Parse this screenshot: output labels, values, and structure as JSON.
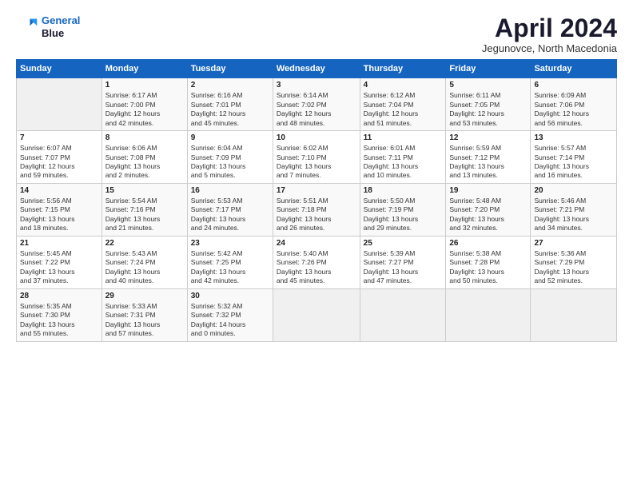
{
  "header": {
    "logo_line1": "General",
    "logo_line2": "Blue",
    "month_title": "April 2024",
    "location": "Jegunovce, North Macedonia"
  },
  "days_of_week": [
    "Sunday",
    "Monday",
    "Tuesday",
    "Wednesday",
    "Thursday",
    "Friday",
    "Saturday"
  ],
  "weeks": [
    [
      {
        "num": "",
        "content": ""
      },
      {
        "num": "1",
        "content": "Sunrise: 6:17 AM\nSunset: 7:00 PM\nDaylight: 12 hours\nand 42 minutes."
      },
      {
        "num": "2",
        "content": "Sunrise: 6:16 AM\nSunset: 7:01 PM\nDaylight: 12 hours\nand 45 minutes."
      },
      {
        "num": "3",
        "content": "Sunrise: 6:14 AM\nSunset: 7:02 PM\nDaylight: 12 hours\nand 48 minutes."
      },
      {
        "num": "4",
        "content": "Sunrise: 6:12 AM\nSunset: 7:04 PM\nDaylight: 12 hours\nand 51 minutes."
      },
      {
        "num": "5",
        "content": "Sunrise: 6:11 AM\nSunset: 7:05 PM\nDaylight: 12 hours\nand 53 minutes."
      },
      {
        "num": "6",
        "content": "Sunrise: 6:09 AM\nSunset: 7:06 PM\nDaylight: 12 hours\nand 56 minutes."
      }
    ],
    [
      {
        "num": "7",
        "content": "Sunrise: 6:07 AM\nSunset: 7:07 PM\nDaylight: 12 hours\nand 59 minutes."
      },
      {
        "num": "8",
        "content": "Sunrise: 6:06 AM\nSunset: 7:08 PM\nDaylight: 13 hours\nand 2 minutes."
      },
      {
        "num": "9",
        "content": "Sunrise: 6:04 AM\nSunset: 7:09 PM\nDaylight: 13 hours\nand 5 minutes."
      },
      {
        "num": "10",
        "content": "Sunrise: 6:02 AM\nSunset: 7:10 PM\nDaylight: 13 hours\nand 7 minutes."
      },
      {
        "num": "11",
        "content": "Sunrise: 6:01 AM\nSunset: 7:11 PM\nDaylight: 13 hours\nand 10 minutes."
      },
      {
        "num": "12",
        "content": "Sunrise: 5:59 AM\nSunset: 7:12 PM\nDaylight: 13 hours\nand 13 minutes."
      },
      {
        "num": "13",
        "content": "Sunrise: 5:57 AM\nSunset: 7:14 PM\nDaylight: 13 hours\nand 16 minutes."
      }
    ],
    [
      {
        "num": "14",
        "content": "Sunrise: 5:56 AM\nSunset: 7:15 PM\nDaylight: 13 hours\nand 18 minutes."
      },
      {
        "num": "15",
        "content": "Sunrise: 5:54 AM\nSunset: 7:16 PM\nDaylight: 13 hours\nand 21 minutes."
      },
      {
        "num": "16",
        "content": "Sunrise: 5:53 AM\nSunset: 7:17 PM\nDaylight: 13 hours\nand 24 minutes."
      },
      {
        "num": "17",
        "content": "Sunrise: 5:51 AM\nSunset: 7:18 PM\nDaylight: 13 hours\nand 26 minutes."
      },
      {
        "num": "18",
        "content": "Sunrise: 5:50 AM\nSunset: 7:19 PM\nDaylight: 13 hours\nand 29 minutes."
      },
      {
        "num": "19",
        "content": "Sunrise: 5:48 AM\nSunset: 7:20 PM\nDaylight: 13 hours\nand 32 minutes."
      },
      {
        "num": "20",
        "content": "Sunrise: 5:46 AM\nSunset: 7:21 PM\nDaylight: 13 hours\nand 34 minutes."
      }
    ],
    [
      {
        "num": "21",
        "content": "Sunrise: 5:45 AM\nSunset: 7:22 PM\nDaylight: 13 hours\nand 37 minutes."
      },
      {
        "num": "22",
        "content": "Sunrise: 5:43 AM\nSunset: 7:24 PM\nDaylight: 13 hours\nand 40 minutes."
      },
      {
        "num": "23",
        "content": "Sunrise: 5:42 AM\nSunset: 7:25 PM\nDaylight: 13 hours\nand 42 minutes."
      },
      {
        "num": "24",
        "content": "Sunrise: 5:40 AM\nSunset: 7:26 PM\nDaylight: 13 hours\nand 45 minutes."
      },
      {
        "num": "25",
        "content": "Sunrise: 5:39 AM\nSunset: 7:27 PM\nDaylight: 13 hours\nand 47 minutes."
      },
      {
        "num": "26",
        "content": "Sunrise: 5:38 AM\nSunset: 7:28 PM\nDaylight: 13 hours\nand 50 minutes."
      },
      {
        "num": "27",
        "content": "Sunrise: 5:36 AM\nSunset: 7:29 PM\nDaylight: 13 hours\nand 52 minutes."
      }
    ],
    [
      {
        "num": "28",
        "content": "Sunrise: 5:35 AM\nSunset: 7:30 PM\nDaylight: 13 hours\nand 55 minutes."
      },
      {
        "num": "29",
        "content": "Sunrise: 5:33 AM\nSunset: 7:31 PM\nDaylight: 13 hours\nand 57 minutes."
      },
      {
        "num": "30",
        "content": "Sunrise: 5:32 AM\nSunset: 7:32 PM\nDaylight: 14 hours\nand 0 minutes."
      },
      {
        "num": "",
        "content": ""
      },
      {
        "num": "",
        "content": ""
      },
      {
        "num": "",
        "content": ""
      },
      {
        "num": "",
        "content": ""
      }
    ]
  ]
}
